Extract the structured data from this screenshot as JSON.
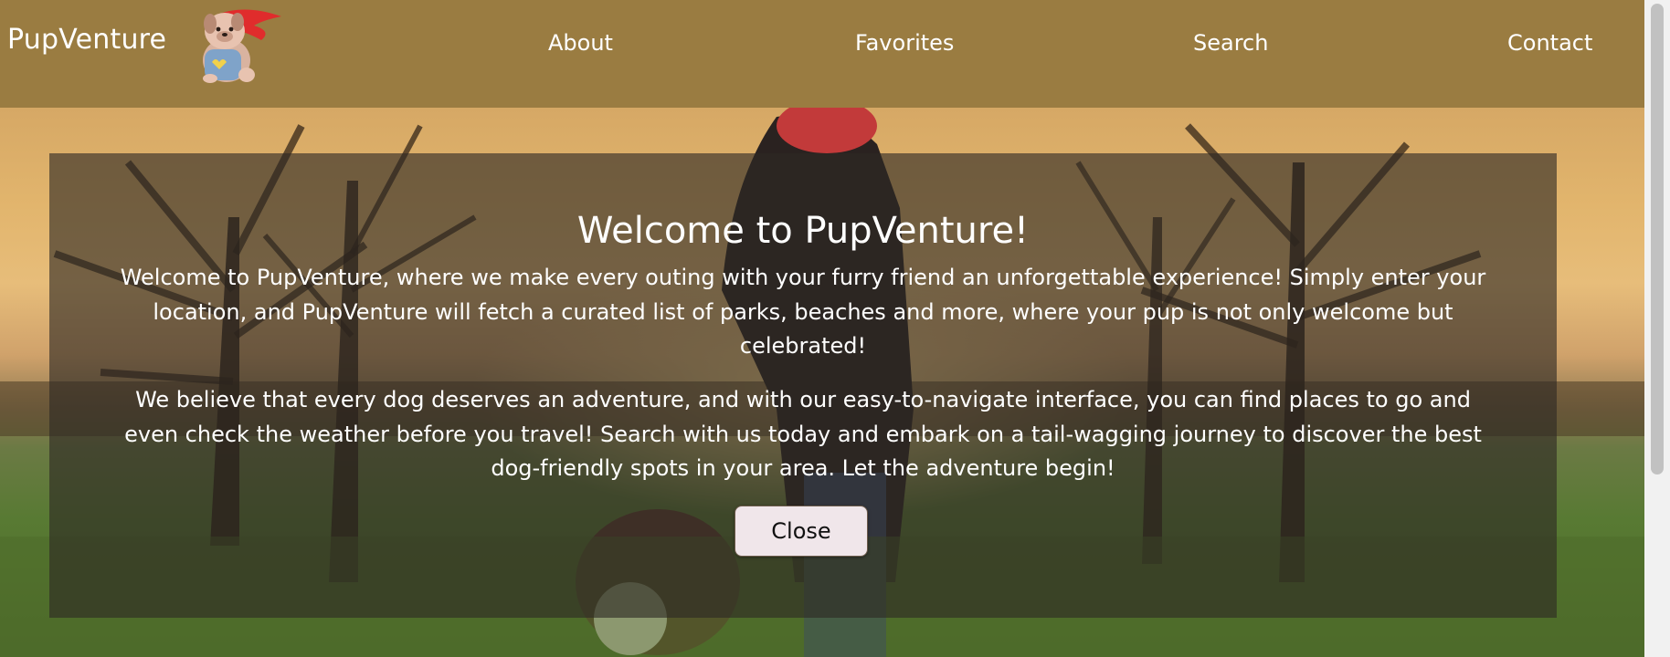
{
  "header": {
    "brand": "PupVenture",
    "logo_icon": "superhero-dog-logo-icon",
    "nav": [
      "About",
      "Favorites",
      "Search",
      "Contact"
    ]
  },
  "modal": {
    "title": "Welcome to PupVenture!",
    "paragraphs": [
      "Welcome to PupVenture, where we make every outing with your furry friend an unforgettable experience! Simply enter your location, and PupVenture will fetch a curated list of parks, beaches and more, where your pup is not only welcome but celebrated!",
      "We believe that every dog deserves an adventure, and with our easy-to-navigate interface, you can find places to go and even check the weather before you travel! Search with us today and embark on a tail-wagging journey to discover the best dog-friendly spots in your area. Let the adventure begin!"
    ],
    "close_label": "Close"
  },
  "colors": {
    "header_bg": "#9a7c41",
    "modal_bg": "rgba(45,40,35,0.62)",
    "button_bg": "#f0e6ea"
  }
}
